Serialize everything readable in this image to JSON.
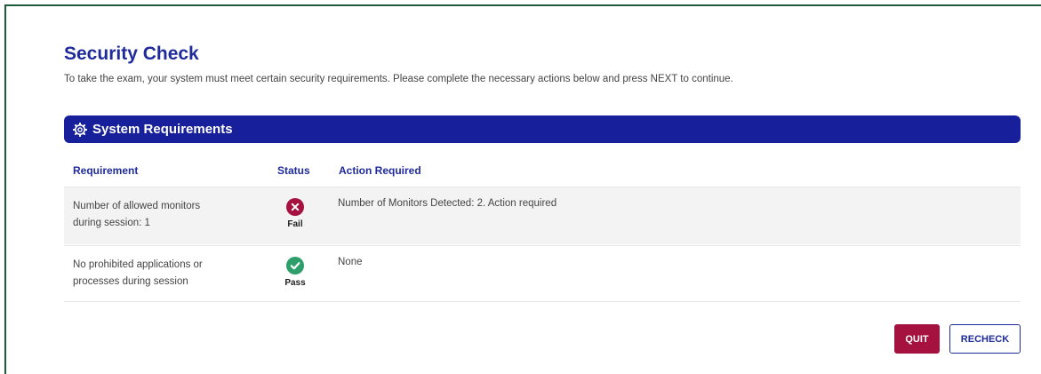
{
  "page": {
    "title": "Security Check",
    "subtitle": "To take the exam, your system must meet certain security requirements. Please complete the necessary actions below and press NEXT to continue."
  },
  "section": {
    "title": "System Requirements",
    "icon": "gear-icon",
    "color": "#17209a"
  },
  "table": {
    "columns": [
      "Requirement",
      "Status",
      "Action Required"
    ],
    "rows": [
      {
        "requirement_line1": "Number of allowed monitors",
        "requirement_line2": "during session: 1",
        "status": "Fail",
        "status_icon": "fail-x-icon",
        "status_color": "#a5123f",
        "action": "Number of Monitors Detected: 2. Action required"
      },
      {
        "requirement_line1": "No prohibited applications or",
        "requirement_line2": "processes during session",
        "status": "Pass",
        "status_icon": "pass-check-icon",
        "status_color": "#2e9e6b",
        "action": "None"
      }
    ]
  },
  "buttons": {
    "quit": "QUIT",
    "recheck": "RECHECK"
  }
}
